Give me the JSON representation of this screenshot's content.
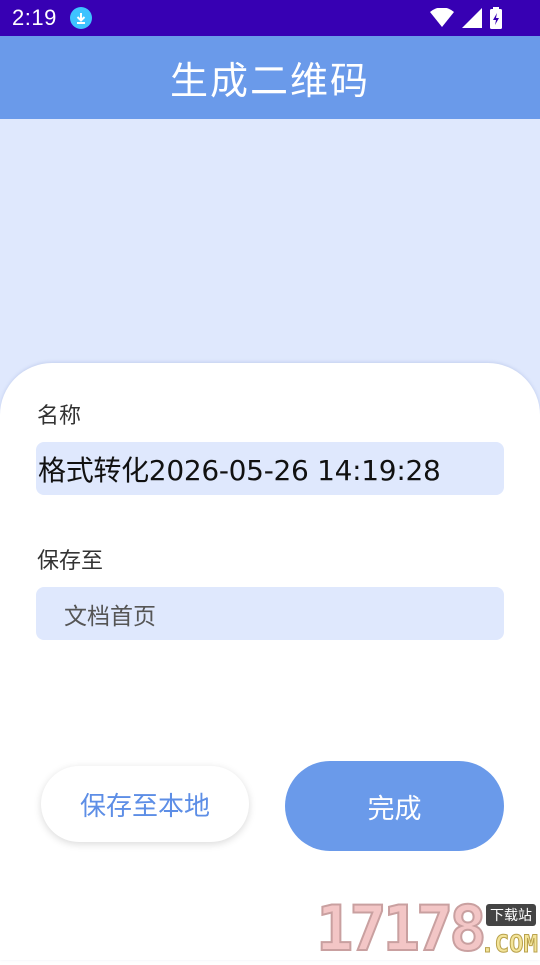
{
  "status_bar": {
    "time": "2:19",
    "icons": [
      "download-icon",
      "wifi-icon",
      "signal-icon",
      "battery-charging-icon"
    ]
  },
  "app_bar": {
    "title": "生成二维码"
  },
  "form": {
    "name_label": "名称",
    "name_value": "格式转化2026-05-26 14:19:28",
    "save_label": "保存至",
    "save_value": "文档首页"
  },
  "actions": {
    "save_local": "保存至本地",
    "done": "完成"
  },
  "watermark": {
    "number": "17178",
    "badge": "下载站",
    "suffix": ".COM"
  },
  "colors": {
    "status_bar": "#3700b3",
    "accent": "#6a9aea",
    "light_bg": "#dfe8fd"
  }
}
